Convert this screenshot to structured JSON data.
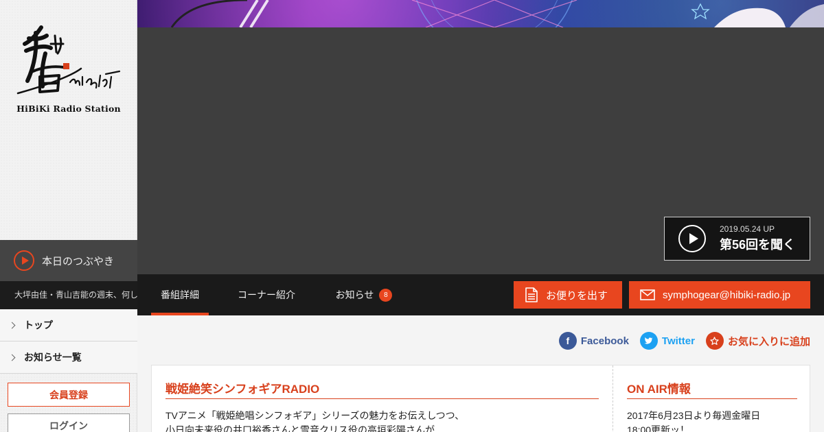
{
  "sidebar": {
    "logo_caption": "HiBiKi Radio Station",
    "tweet_title": "本日のつぶやき",
    "tweet_text": "大坪由佳・青山吉能の週末、何して",
    "nav": [
      {
        "label": "トップ"
      },
      {
        "label": "お知らせ一覧"
      }
    ],
    "register_label": "会員登録",
    "login_label": "ログイン"
  },
  "hero": {
    "date": "2019.05.24 UP",
    "episode": "第56回を聞く"
  },
  "tabs": [
    {
      "label": "番組詳細",
      "active": true
    },
    {
      "label": "コーナー紹介",
      "active": false
    },
    {
      "label": "お知らせ",
      "active": false,
      "badge": "8"
    }
  ],
  "actions": {
    "letter_label": "お便りを出す",
    "email_label": "symphogear@hibiki-radio.jp"
  },
  "share": {
    "facebook": "Facebook",
    "twitter": "Twitter",
    "favorite": "お気に入りに追加"
  },
  "program": {
    "title": "戦姫絶笑シンフォギアRADIO",
    "line1": "TVアニメ「戦姫絶唱シンフォギア」シリーズの魅力をお伝えしつつ、",
    "line2": "小日向未来役の井口裕香さんと雪音クリス役の高垣彩陽さんが"
  },
  "onair": {
    "title": "ON AIR情報",
    "line1": "2017年6月23日より毎週金曜日",
    "line2": "18:00更新ッ！"
  },
  "colors": {
    "accent": "#e8461f",
    "dark": "#1a1a1a",
    "facebook": "#3b5998",
    "twitter": "#1da1f2"
  },
  "icons": [
    "play-icon",
    "letter-icon",
    "mail-icon",
    "facebook-icon",
    "twitter-icon",
    "star-icon",
    "chevron-right-icon"
  ]
}
